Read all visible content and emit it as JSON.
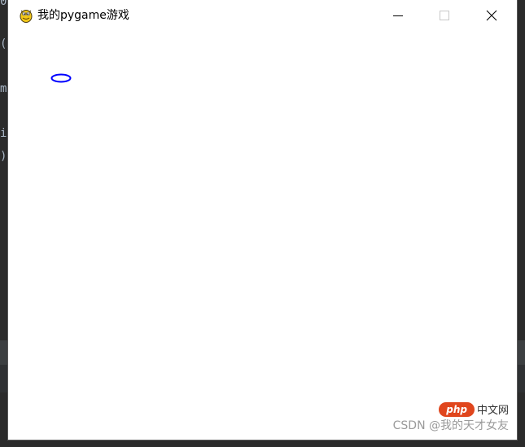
{
  "background_editor": {
    "code_glyphs": [
      "0",
      "(",
      "m",
      "i",
      ")"
    ]
  },
  "window": {
    "title": "我的pygame游戏",
    "app_icon": "pygame-snake-icon",
    "controls": {
      "minimize": "minimize-icon",
      "maximize": "maximize-icon",
      "close": "close-icon"
    }
  },
  "canvas": {
    "background_color": "#ffffff",
    "shape": {
      "type": "ellipse",
      "stroke_color": "#0000ff"
    }
  },
  "watermark": {
    "php_badge": "php",
    "php_site": "中文网",
    "credit": "CSDN @我的天才女友"
  }
}
